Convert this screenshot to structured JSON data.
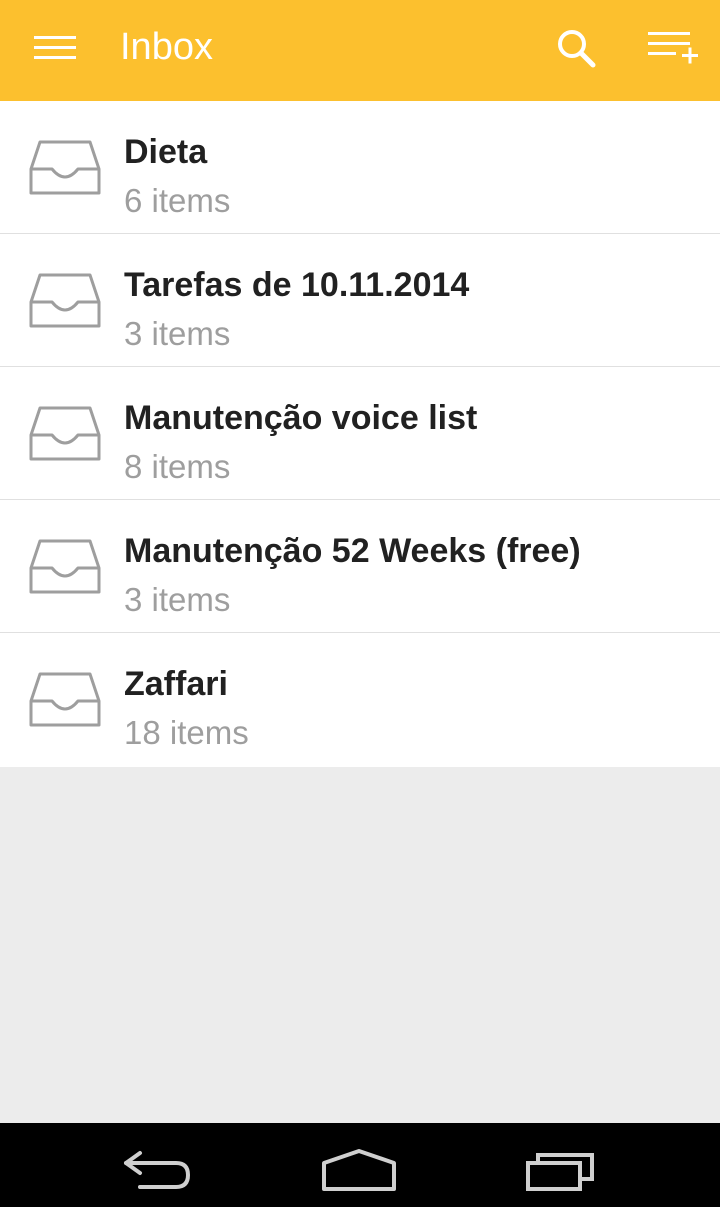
{
  "colors": {
    "accent": "#fcc02e",
    "background": "#ececec",
    "title_text": "#212121",
    "subtitle_text": "#9e9e9e",
    "icon_gray": "#9e9e9e"
  },
  "appbar": {
    "title": "Inbox",
    "icons": [
      "menu-icon",
      "search-icon",
      "add-list-icon"
    ]
  },
  "lists": [
    {
      "title": "Dieta",
      "subtitle": "6 items",
      "icon": "inbox-tray-icon"
    },
    {
      "title": "Tarefas de 10.11.2014",
      "subtitle": "3 items",
      "icon": "inbox-tray-icon"
    },
    {
      "title": "Manutenção voice list",
      "subtitle": "8 items",
      "icon": "inbox-tray-icon"
    },
    {
      "title": "Manutenção 52 Weeks (free)",
      "subtitle": "3 items",
      "icon": "inbox-tray-icon"
    },
    {
      "title": "Zaffari",
      "subtitle": "18 items",
      "icon": "inbox-tray-icon"
    }
  ],
  "navbar": {
    "icons": [
      "back-icon",
      "home-icon",
      "recents-icon"
    ]
  }
}
